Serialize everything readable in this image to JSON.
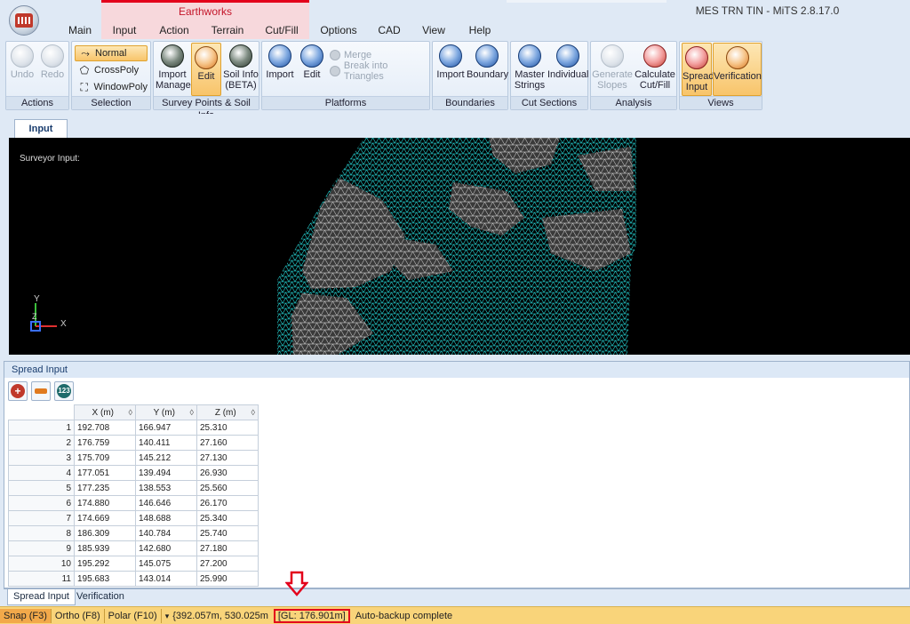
{
  "app": {
    "title": "MES TRN TIN - MiTS 2.8.17.0"
  },
  "context_group": {
    "label": "Earthworks"
  },
  "menu": [
    "Main",
    "Input",
    "Action",
    "Terrain",
    "Cut/Fill",
    "Options",
    "CAD",
    "View",
    "Help"
  ],
  "ribbon": {
    "actions": {
      "label": "Actions",
      "undo": "Undo",
      "redo": "Redo"
    },
    "selection": {
      "label": "Selection",
      "items": [
        "Normal",
        "CrossPoly",
        "WindowPoly"
      ]
    },
    "survey": {
      "label": "Survey Points & Soil Info",
      "import_manage_1": "Import",
      "import_manage_2": "Manage",
      "edit": "Edit",
      "soil_1": "Soil Info",
      "soil_2": "(BETA)"
    },
    "platforms": {
      "label": "Platforms",
      "import": "Import",
      "edit": "Edit",
      "merge": "Merge",
      "break": "Break into Triangles"
    },
    "boundaries": {
      "label": "Boundaries",
      "import": "Import",
      "boundary": "Boundary"
    },
    "cut_sections": {
      "label": "Cut Sections",
      "master_1": "Master",
      "master_2": "Strings",
      "individual": "Individual"
    },
    "analysis": {
      "label": "Analysis",
      "gen_1": "Generate",
      "gen_2": "Slopes",
      "calc_1": "Calculate",
      "calc_2": "Cut/Fill"
    },
    "views": {
      "label": "Views",
      "spread_1": "Spread",
      "spread_2": "Input",
      "verification": "Verification"
    }
  },
  "doc_tab": "Input",
  "viewport": {
    "label": "Surveyor Input:",
    "axis_y": "Y",
    "axis_x": "X",
    "axis_z": "Z"
  },
  "panel": {
    "title": "Spread Input",
    "columns": [
      "X (m)",
      "Y (m)",
      "Z (m)"
    ],
    "rows": [
      {
        "n": "1",
        "x": "192.708",
        "y": "166.947",
        "z": "25.310"
      },
      {
        "n": "2",
        "x": "176.759",
        "y": "140.411",
        "z": "27.160"
      },
      {
        "n": "3",
        "x": "175.709",
        "y": "145.212",
        "z": "27.130"
      },
      {
        "n": "4",
        "x": "177.051",
        "y": "139.494",
        "z": "26.930"
      },
      {
        "n": "5",
        "x": "177.235",
        "y": "138.553",
        "z": "25.560"
      },
      {
        "n": "6",
        "x": "174.880",
        "y": "146.646",
        "z": "26.170"
      },
      {
        "n": "7",
        "x": "174.669",
        "y": "148.688",
        "z": "25.340"
      },
      {
        "n": "8",
        "x": "186.309",
        "y": "140.784",
        "z": "25.740"
      },
      {
        "n": "9",
        "x": "185.939",
        "y": "142.680",
        "z": "27.180"
      },
      {
        "n": "10",
        "x": "195.292",
        "y": "145.075",
        "z": "27.200"
      },
      {
        "n": "11",
        "x": "195.683",
        "y": "143.014",
        "z": "25.990"
      }
    ]
  },
  "bottom_tabs": [
    "Spread Input",
    "Verification"
  ],
  "status": {
    "snap": "Snap (F3)",
    "ortho": "Ortho (F8)",
    "polar": "Polar (F10)",
    "coords": "{392.057m, 530.025m",
    "gl": "[GL: 176.901m]",
    "message": "Auto-backup complete"
  },
  "colors": {
    "mesh": "#26d7d7",
    "mesh_dark": "#3a3a3a",
    "status_bar": "#f9d47a",
    "highlight": "#e3001b"
  }
}
